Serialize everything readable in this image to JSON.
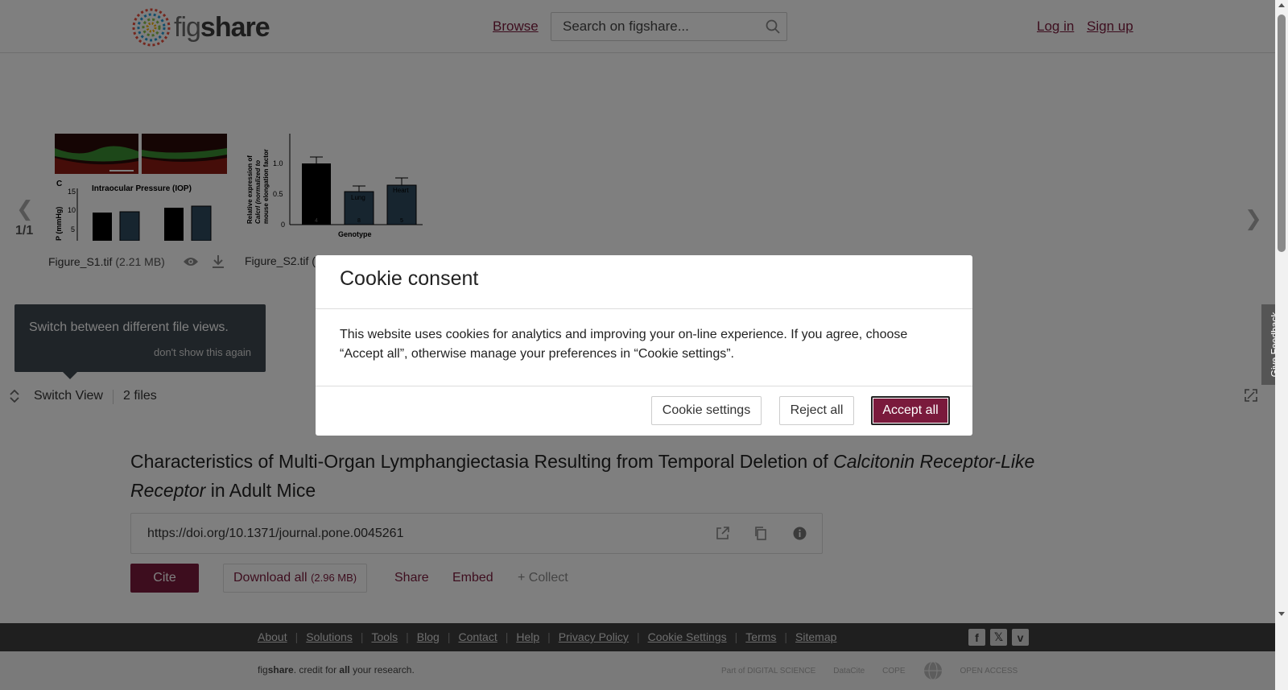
{
  "header": {
    "logo_prefix": "fig",
    "logo_suffix": "share",
    "browse_label": "Browse",
    "search_placeholder": "Search on figshare...",
    "login_label": "Log in",
    "signup_label": "Sign up"
  },
  "viewer": {
    "counter": "1/1",
    "files": [
      {
        "name": "Figure_S1.tif",
        "size": "(2.21 MB)"
      },
      {
        "name": "Figure_S2.tif",
        "size": "("
      }
    ],
    "thumb1_panel_label": "C",
    "thumb1_heading": "Intraocular Pressure (IOP)",
    "thumb1_ylabel": "P (mmHg)",
    "thumb1_ticks": [
      "15",
      "10",
      "5"
    ],
    "thumb2_ylabel_1": "Relative expression of",
    "thumb2_ylabel_2": "Calcrl (normalized to",
    "thumb2_ylabel_3": "mouse elongation factor",
    "thumb2_ticks": [
      "1.0",
      "0.5",
      "0"
    ],
    "thumb2_bar_labels": [
      "Lung",
      "Heart"
    ],
    "thumb2_counts": [
      "4",
      "8",
      "5"
    ],
    "thumb2_xlabel": "Genotype",
    "tooltip_text": "Switch between different file views.",
    "tooltip_dismiss": "don't show this again",
    "switch_view_label": "Switch View",
    "files_count": "2 files"
  },
  "content": {
    "title_part1": "Characteristics of Multi-Organ Lymphangiectasia Resulting from Temporal Deletion of ",
    "title_italic1": "Calcitonin Receptor-Like Receptor",
    "title_part2": " in Adult Mice",
    "doi": "https://doi.org/10.1371/journal.pone.0045261",
    "cite_label": "Cite",
    "download_label": "Download all",
    "download_size": "(2.96 MB)",
    "share_label": "Share",
    "embed_label": "Embed",
    "collect_label": "+ Collect"
  },
  "footer": {
    "links": [
      "About",
      "Solutions",
      "Tools",
      "Blog",
      "Contact",
      "Help",
      "Privacy Policy",
      "Cookie Settings",
      "Terms",
      "Sitemap"
    ],
    "tagline_fig": "fig",
    "tagline_share": "share",
    "tagline_mid": ". credit for ",
    "tagline_all": "all",
    "tagline_end": " your research.",
    "partner_digital": "Part of DIGITAL SCIENCE",
    "partner_datacite": "DataCite",
    "partner_cope": "COPE",
    "partner_openaccess": "OPEN ACCESS"
  },
  "modal": {
    "title": "Cookie consent",
    "body": "This website uses cookies for analytics and improving your on-line experience. If you agree, choose “Accept all”, otherwise manage your preferences in “Cookie settings”.",
    "settings_label": "Cookie settings",
    "reject_label": "Reject all",
    "accept_label": "Accept all"
  },
  "feedback_label": "Give Feedback",
  "colors": {
    "brand": "#7a1a3c",
    "overlay": "rgba(0,0,0,0.5)",
    "footer_dark": "#3e3e3e"
  }
}
